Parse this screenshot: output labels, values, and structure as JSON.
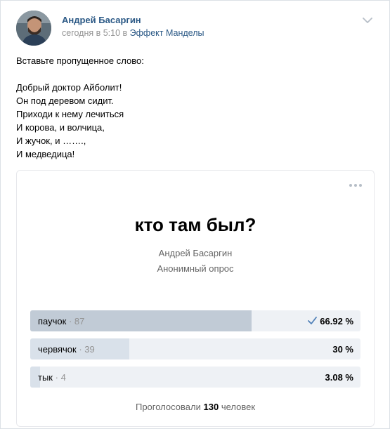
{
  "post": {
    "author": "Андрей Басаргин",
    "time_text": "сегодня в 5:10 в",
    "group": "Эффект Манделы",
    "text_lines": [
      "Вставьте пропущенное слово:",
      "",
      "Добрый доктор Айболит!",
      "Он под деревом сидит.",
      "Приходи к нему лечиться",
      "И корова, и волчица,",
      "И жучок, и …….,",
      "И медведица!"
    ]
  },
  "poll": {
    "question": "кто там был?",
    "author": "Андрей Басаргин",
    "type": "Анонимный опрос",
    "answers": [
      {
        "label": "паучок",
        "count": "· 87",
        "percent": "66.92 %",
        "fraction": 0.6692,
        "chosen": true
      },
      {
        "label": "червячок",
        "count": "· 39",
        "percent": "30 %",
        "fraction": 0.3,
        "chosen": false
      },
      {
        "label": "тык",
        "count": "· 4",
        "percent": "3.08 %",
        "fraction": 0.0308,
        "chosen": false
      }
    ],
    "total_prefix": "Проголосовали",
    "total_count": "130",
    "total_suffix": "человек"
  },
  "icons": {
    "menu": "chevron-down-icon",
    "poll_menu": "more-horizontal-icon",
    "chosen": "check-icon"
  },
  "colors": {
    "link": "#2a5885",
    "bar_chosen": "#c1cbd6",
    "bar": "#d9e1ea",
    "track": "#eef1f5"
  }
}
